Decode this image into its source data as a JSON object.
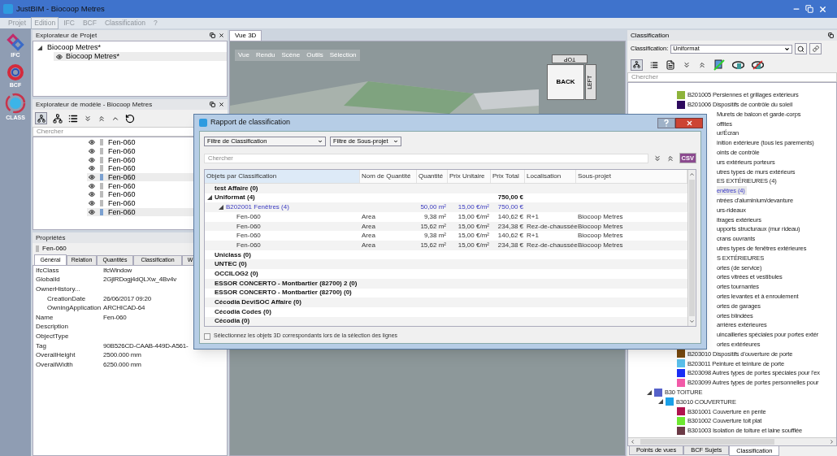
{
  "window": {
    "title": "JustBIM - Biocoop Metres"
  },
  "menu": [
    {
      "label": "Projet",
      "disabled": true,
      "highlighted": false
    },
    {
      "label": "Edition",
      "disabled": true,
      "highlighted": true
    },
    {
      "label": "IFC",
      "disabled": true,
      "highlighted": false
    },
    {
      "label": "BCF",
      "disabled": true,
      "highlighted": false
    },
    {
      "label": "Classification",
      "disabled": true,
      "highlighted": false
    },
    {
      "label": "?",
      "disabled": true,
      "highlighted": false
    }
  ],
  "app_bar": [
    {
      "kind": "ifc",
      "label": "IFC"
    },
    {
      "kind": "bcf",
      "label": "BCF"
    },
    {
      "kind": "class",
      "label": "CLASS"
    }
  ],
  "project_explorer": {
    "title": "Explorateur de Projet",
    "tree": [
      {
        "label": "Biocoop Metres*",
        "expanded": true,
        "selected": false,
        "children": [
          {
            "label": "Biocoop Metres*",
            "selected": true
          }
        ]
      }
    ]
  },
  "model_explorer": {
    "title": "Explorateur de modèle - Biocoop Metres",
    "search": {
      "placeholder": "Chercher"
    },
    "rows": [
      {
        "label": "Fen-060",
        "selected": false
      },
      {
        "label": "Fen-060",
        "selected": false
      },
      {
        "label": "Fen-060",
        "selected": false
      },
      {
        "label": "Fen-060",
        "selected": false
      },
      {
        "label": "Fen-060",
        "selected": true
      },
      {
        "label": "Fen-060",
        "selected": false
      },
      {
        "label": "Fen-060",
        "selected": false
      },
      {
        "label": "Fen-060",
        "selected": false
      },
      {
        "label": "Fen-060",
        "selected": true
      }
    ]
  },
  "properties": {
    "title": "Propriétés",
    "object": "Fen-060",
    "tabs": [
      {
        "label": "Général",
        "selected": true
      },
      {
        "label": "Relation",
        "selected": false
      },
      {
        "label": "Quantités",
        "selected": false
      },
      {
        "label": "Classification",
        "selected": false
      },
      {
        "label": "W",
        "selected": false
      }
    ],
    "rows": [
      {
        "name": "IfcClass",
        "value": "IfcWindow"
      },
      {
        "name": "GlobalId",
        "value": "2GjIRDogj4dQLXw_4Bv4v"
      },
      {
        "name": "OwnerHistory...",
        "children": [
          {
            "name": "CreationDate",
            "value": "26/06/2017 09:20"
          },
          {
            "name": "OwningApplication",
            "value": "ARCHICAD-64"
          }
        ]
      },
      {
        "name": "Name",
        "value": "Fen-060"
      },
      {
        "name": "Description"
      },
      {
        "name": "ObjectType"
      },
      {
        "name": "Tag",
        "value": "90B526CD-CAAB-449D-A561-"
      },
      {
        "name": "OverallHeight",
        "value": "2500.000 mm"
      },
      {
        "name": "OverallWidth",
        "value": "6250.000 mm"
      }
    ]
  },
  "viewport": {
    "tab": "Vue 3D",
    "menu": [
      "Vue",
      "Rendu",
      "Scène",
      "Outils",
      "Sélection"
    ],
    "nav_cube": {
      "front": "BACK",
      "side": "LEFT",
      "top": "TOP"
    }
  },
  "classification_panel": {
    "title": "Classification",
    "label": "Classification:",
    "select": "Uniformat",
    "search": {
      "placeholder": "Chercher"
    },
    "tree": [
      {
        "children": [
          {
            "children": [
              {
                "label": "B201005 Persiennes et grillages extérieurs",
                "color": "#8db33a"
              },
              {
                "label": "B201006 Dispositifs de contrôle du soleil",
                "color": "#2e0a5e"
              },
              {
                "label": "Murets de balcon et garde-corps",
                "partial": true
              },
              {
                "label": "offites",
                "partial": true
              },
              {
                "label": "ur/Écran",
                "partial": true
              },
              {
                "label": "inition extérieure (tous les parements)",
                "partial": true
              },
              {
                "label": "oints de contrôle",
                "partial": true
              },
              {
                "label": "urs extérieurs porteurs",
                "partial": true
              },
              {
                "label": "utres types de murs extérieurs",
                "partial": true
              },
              {
                "label": "ES EXTÉRIEURES (4)",
                "partial": true
              },
              {
                "label": "enêtres (4)",
                "partial": true,
                "selected": true
              },
              {
                "label": "ntrées d'aluminium/devanture",
                "partial": true
              },
              {
                "label": "urs-rideaux",
                "partial": true
              },
              {
                "label": "itrages extérieurs",
                "partial": true
              },
              {
                "label": "upports structuraux (mur rideau)",
                "partial": true
              },
              {
                "label": "crans ouvrants",
                "partial": true
              },
              {
                "label": "utres types de fenêtres extérieures",
                "partial": true
              },
              {
                "label": "S EXTÉRIEURES",
                "partial": true
              },
              {
                "label": "ortes (de service)",
                "partial": true
              },
              {
                "label": "ortes vitrées et vestibules",
                "partial": true
              },
              {
                "label": "ortes tournantes",
                "partial": true
              },
              {
                "label": "ortes levantes et à enroulement",
                "partial": true
              },
              {
                "label": "ortes de garages",
                "partial": true
              },
              {
                "label": "ortes blindées",
                "partial": true
              },
              {
                "label": "arrières extérieures",
                "partial": true
              },
              {
                "label": "uincailleries spéciales pour portes extér",
                "partial": true
              },
              {
                "label": "ortes extérieures",
                "partial": true
              },
              {
                "label": "B203010 Dispositifs d'ouverture de porte",
                "color": "#7a4a0e"
              },
              {
                "label": "B203011 Peinture et teinture de porte",
                "color": "#5bc0eb"
              },
              {
                "label": "B203098 Autres types de portes spéciales pour l'ex",
                "color": "#1a2ef5"
              },
              {
                "label": "B203099 Autres types de portes personnelles pour",
                "color": "#f25aa8"
              }
            ]
          }
        ]
      },
      {
        "label": "B30 TOITURE",
        "color": "#5561c9",
        "expanded": true,
        "children": [
          {
            "label": "B3010 COUVERTURE",
            "color": "#1aa0e8",
            "expanded": true,
            "children": [
              {
                "label": "B301001 Couverture en pente",
                "color": "#b0134e"
              },
              {
                "label": "B301002 Couverture toit plat",
                "color": "#6fe832"
              },
              {
                "label": "B301003 Isolation de toiture et laine soufflée",
                "color": "#6b3a46"
              }
            ]
          }
        ]
      }
    ],
    "tabs": [
      {
        "label": "Points de vues",
        "selected": false
      },
      {
        "label": "BCF Sujets",
        "selected": false
      },
      {
        "label": "Classification",
        "selected": true
      }
    ]
  },
  "dialog": {
    "title": "Rapport de classification",
    "filters": [
      "Filtre de Classification",
      "Filtre de Sous-projet"
    ],
    "search": {
      "placeholder": "Chercher"
    },
    "export_label": "CSV",
    "columns": [
      "Objets par Classification",
      "Nom de Quantité",
      "Quantité",
      "Prix Unitaire",
      "Prix Total",
      "Localisation",
      "Sous-projet"
    ],
    "rows": [
      {
        "kind": "group",
        "label": "test Affaire (0)"
      },
      {
        "kind": "group",
        "label": "Uniformat (4)",
        "expanded": true,
        "total": "750,00 €"
      },
      {
        "kind": "subgroup",
        "label": "B202001 Fenêtres (4)",
        "expanded": true,
        "quantity": "50,00 m²",
        "unit_price": "15,00 €/m²",
        "total": "750,00 €"
      },
      {
        "kind": "item",
        "label": "Fen-060",
        "quantity_name": "Area",
        "quantity": "9,38 m²",
        "unit_price": "15,00 €/m²",
        "total": "140,62 €",
        "location": "R+1",
        "subproject": "Biocoop Metres"
      },
      {
        "kind": "item",
        "label": "Fen-060",
        "quantity_name": "Area",
        "quantity": "15,62 m²",
        "unit_price": "15,00 €/m²",
        "total": "234,38 €",
        "location": "Rez-de-chaussée",
        "subproject": "Biocoop Metres"
      },
      {
        "kind": "item",
        "label": "Fen-060",
        "quantity_name": "Area",
        "quantity": "9,38 m²",
        "unit_price": "15,00 €/m²",
        "total": "140,62 €",
        "location": "R+1",
        "subproject": "Biocoop Metres"
      },
      {
        "kind": "item",
        "label": "Fen-060",
        "quantity_name": "Area",
        "quantity": "15,62 m²",
        "unit_price": "15,00 €/m²",
        "total": "234,38 €",
        "location": "Rez-de-chaussée",
        "subproject": "Biocoop Metres"
      },
      {
        "kind": "group",
        "label": "Uniclass (0)"
      },
      {
        "kind": "group",
        "label": "UNTEC (0)"
      },
      {
        "kind": "group",
        "label": "OCCILOG2 (0)"
      },
      {
        "kind": "group",
        "label": "ESSOR CONCERTO - Montbartier (82700) 2 (0)"
      },
      {
        "kind": "group",
        "label": "ESSOR CONCERTO - Montbartier (82700) (0)"
      },
      {
        "kind": "group",
        "label": "Cécodia DeviSOC Affaire (0)"
      },
      {
        "kind": "group",
        "label": "Cécodia Codes (0)"
      },
      {
        "kind": "group",
        "label": "Cécodia (0)"
      }
    ],
    "checkbox": {
      "label": "Sélectionnez les objets 3D correspondants lors de la sélection des lignes",
      "checked": false
    }
  }
}
